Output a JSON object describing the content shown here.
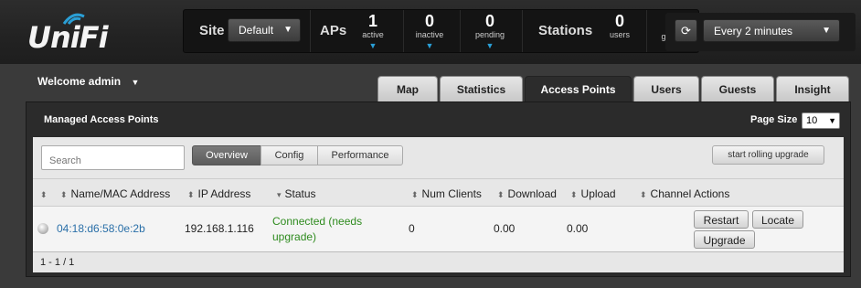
{
  "header": {
    "logo_text": "UniFi",
    "site_label": "Site",
    "site_value": "Default",
    "aps_label": "APs",
    "aps": [
      {
        "count": "1",
        "label": "active"
      },
      {
        "count": "0",
        "label": "inactive"
      },
      {
        "count": "0",
        "label": "pending"
      }
    ],
    "stations_label": "Stations",
    "users": {
      "count": "0",
      "label": "users"
    },
    "guests_partial": "g",
    "refresh_interval": "Every 2 minutes"
  },
  "welcome": "Welcome admin",
  "tabs": [
    "Map",
    "Statistics",
    "Access Points",
    "Users",
    "Guests",
    "Insight"
  ],
  "active_tab": "Access Points",
  "panel": {
    "title": "Managed Access Points",
    "page_size_label": "Page Size",
    "page_size": "10",
    "search_placeholder": "Search",
    "views": [
      "Overview",
      "Config",
      "Performance"
    ],
    "rolling_upgrade": "start rolling upgrade"
  },
  "table": {
    "columns": [
      "Name/MAC Address",
      "IP Address",
      "Status",
      "Num Clients",
      "Download",
      "Upload",
      "Channel",
      "Actions"
    ],
    "rows": [
      {
        "mac": "04:18:d6:58:0e:2b",
        "ip": "192.168.1.116",
        "status": "Connected (needs upgrade)",
        "num_clients": "0",
        "download": "0.00",
        "upload": "0.00",
        "channel": "",
        "actions": [
          "Restart",
          "Locate",
          "Upgrade"
        ]
      }
    ]
  },
  "pagination": "1 - 1 / 1",
  "colors": {
    "accent": "#2a9fd6",
    "status_ok": "#2e8b1e",
    "link": "#2a6fa8"
  }
}
